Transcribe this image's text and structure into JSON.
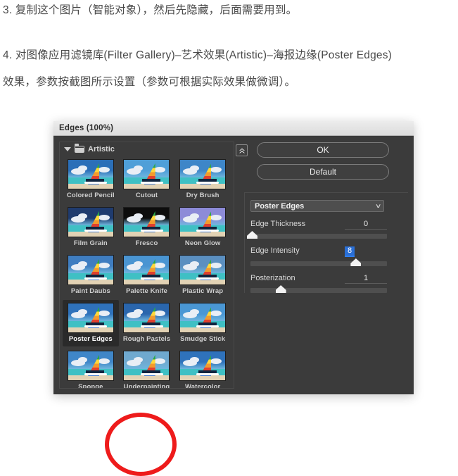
{
  "tutorial": {
    "line1": "3. 复制这个图片（智能对象），然后先隐藏，后面需要用到。",
    "line2": "4. 对图像应用滤镜库(Filter Gallery)–艺术效果(Artistic)–海报边缘(Poster Edges)",
    "line3": "效果，参数按截图所示设置（参数可根据实际效果做微调）。"
  },
  "dialog": {
    "title": "Edges (100%)",
    "gallery": {
      "category_label": "Artistic",
      "disclosure_icon": "triangle-down-icon",
      "folder_icon": "folder-icon",
      "selected_filter": "Poster Edges",
      "filters": [
        "Colored Pencil",
        "Cutout",
        "Dry Brush",
        "Film Grain",
        "Fresco",
        "Neon Glow",
        "Paint Daubs",
        "Palette Knife",
        "Plastic Wrap",
        "Poster Edges",
        "Rough Pastels",
        "Smudge Stick",
        "Sponge",
        "Underpainting",
        "Watercolor"
      ]
    },
    "controls": {
      "collapse_icon": "double-chevron-up-icon",
      "ok_label": "OK",
      "default_label": "Default",
      "filter_select_value": "Poster Edges",
      "filter_select_chevron": "chevron-down-icon",
      "params": [
        {
          "label": "Edge Thickness",
          "value": "0",
          "percent": 1,
          "active": false
        },
        {
          "label": "Edge Intensity",
          "value": "8",
          "percent": 77,
          "active": true
        },
        {
          "label": "Posterization",
          "value": "1",
          "percent": 22,
          "active": false
        }
      ]
    }
  },
  "annotation": {
    "shape": "red-ellipse-highlight",
    "color": "#ee1b1b",
    "targets": "Poster Edges"
  }
}
